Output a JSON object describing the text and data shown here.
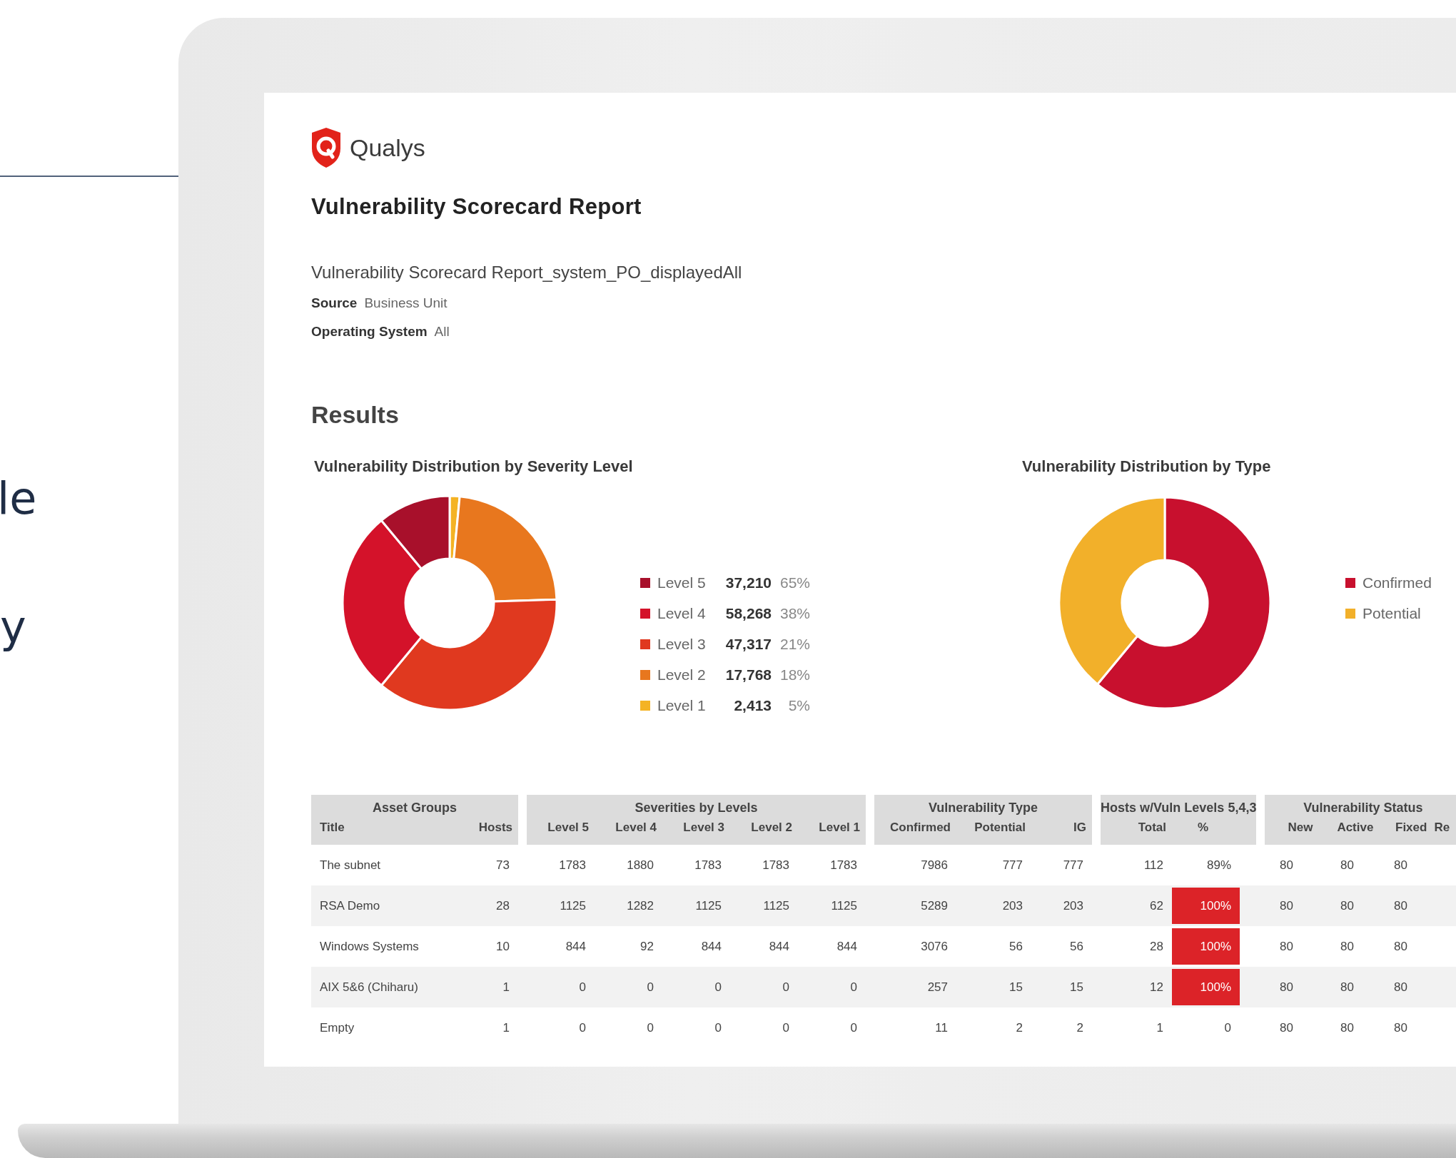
{
  "side_text": {
    "fragments": [
      "le",
      "y"
    ]
  },
  "report": {
    "brand": "Qualys",
    "title": "Vulnerability Scorecard Report",
    "report_name": "Vulnerability Scorecard Report_system_PO_displayedAll",
    "meta": [
      {
        "label": "Source",
        "value": "Business Unit"
      },
      {
        "label": "Operating System",
        "value": "All"
      }
    ],
    "section_title": "Results",
    "severity_chart": {
      "title": "Vulnerability Distribution by Severity Level",
      "legend": [
        {
          "label": "Level 5",
          "count": "37,210",
          "percent": "65%",
          "color": "#a8102b"
        },
        {
          "label": "Level 4",
          "count": "58,268",
          "percent": "38%",
          "color": "#d4122a"
        },
        {
          "label": "Level 3",
          "count": "47,317",
          "percent": "21%",
          "color": "#e0391f"
        },
        {
          "label": "Level 2",
          "count": "17,768",
          "percent": "18%",
          "color": "#e8771e"
        },
        {
          "label": "Level 1",
          "count": "2,413",
          "percent": "5%",
          "color": "#f4b324"
        }
      ]
    },
    "type_chart": {
      "title": "Vulnerability Distribution by Type",
      "legend": [
        {
          "label": "Confirmed",
          "color": "#c8102e"
        },
        {
          "label": "Potential",
          "color": "#f2b02a"
        }
      ]
    },
    "table": {
      "groups": [
        {
          "label": "Asset Groups",
          "columns": [
            "Title",
            "Hosts"
          ]
        },
        {
          "label": "Severities by Levels",
          "columns": [
            "Level 5",
            "Level 4",
            "Level 3",
            "Level 2",
            "Level 1"
          ]
        },
        {
          "label": "Vulnerability Type",
          "columns": [
            "Confirmed",
            "Potential",
            "IG"
          ]
        },
        {
          "label": "Hosts w/Vuln Levels 5,4,3",
          "columns": [
            "Total",
            "%"
          ]
        },
        {
          "label": "Vulnerability Status",
          "columns": [
            "New",
            "Active",
            "Fixed",
            "Re"
          ]
        }
      ],
      "rows": [
        {
          "cells": [
            "The subnet",
            "73",
            "1783",
            "1880",
            "1783",
            "1783",
            "1783",
            "7986",
            "777",
            "777",
            "112",
            "89%",
            "80",
            "80",
            "80"
          ],
          "alert": false
        },
        {
          "cells": [
            "RSA Demo",
            "28",
            "1125",
            "1282",
            "1125",
            "1125",
            "1125",
            "5289",
            "203",
            "203",
            "62",
            "100%",
            "80",
            "80",
            "80"
          ],
          "alert": true
        },
        {
          "cells": [
            "Windows Systems",
            "10",
            "844",
            "92",
            "844",
            "844",
            "844",
            "3076",
            "56",
            "56",
            "28",
            "100%",
            "80",
            "80",
            "80"
          ],
          "alert": true
        },
        {
          "cells": [
            "AIX 5&6 (Chiharu)",
            "1",
            "0",
            "0",
            "0",
            "0",
            "0",
            "257",
            "15",
            "15",
            "12",
            "100%",
            "80",
            "80",
            "80"
          ],
          "alert": true
        },
        {
          "cells": [
            "Empty",
            "1",
            "0",
            "0",
            "0",
            "0",
            "0",
            "11",
            "2",
            "2",
            "1",
            "0",
            "80",
            "80",
            "80"
          ],
          "alert": false
        }
      ]
    }
  }
}
